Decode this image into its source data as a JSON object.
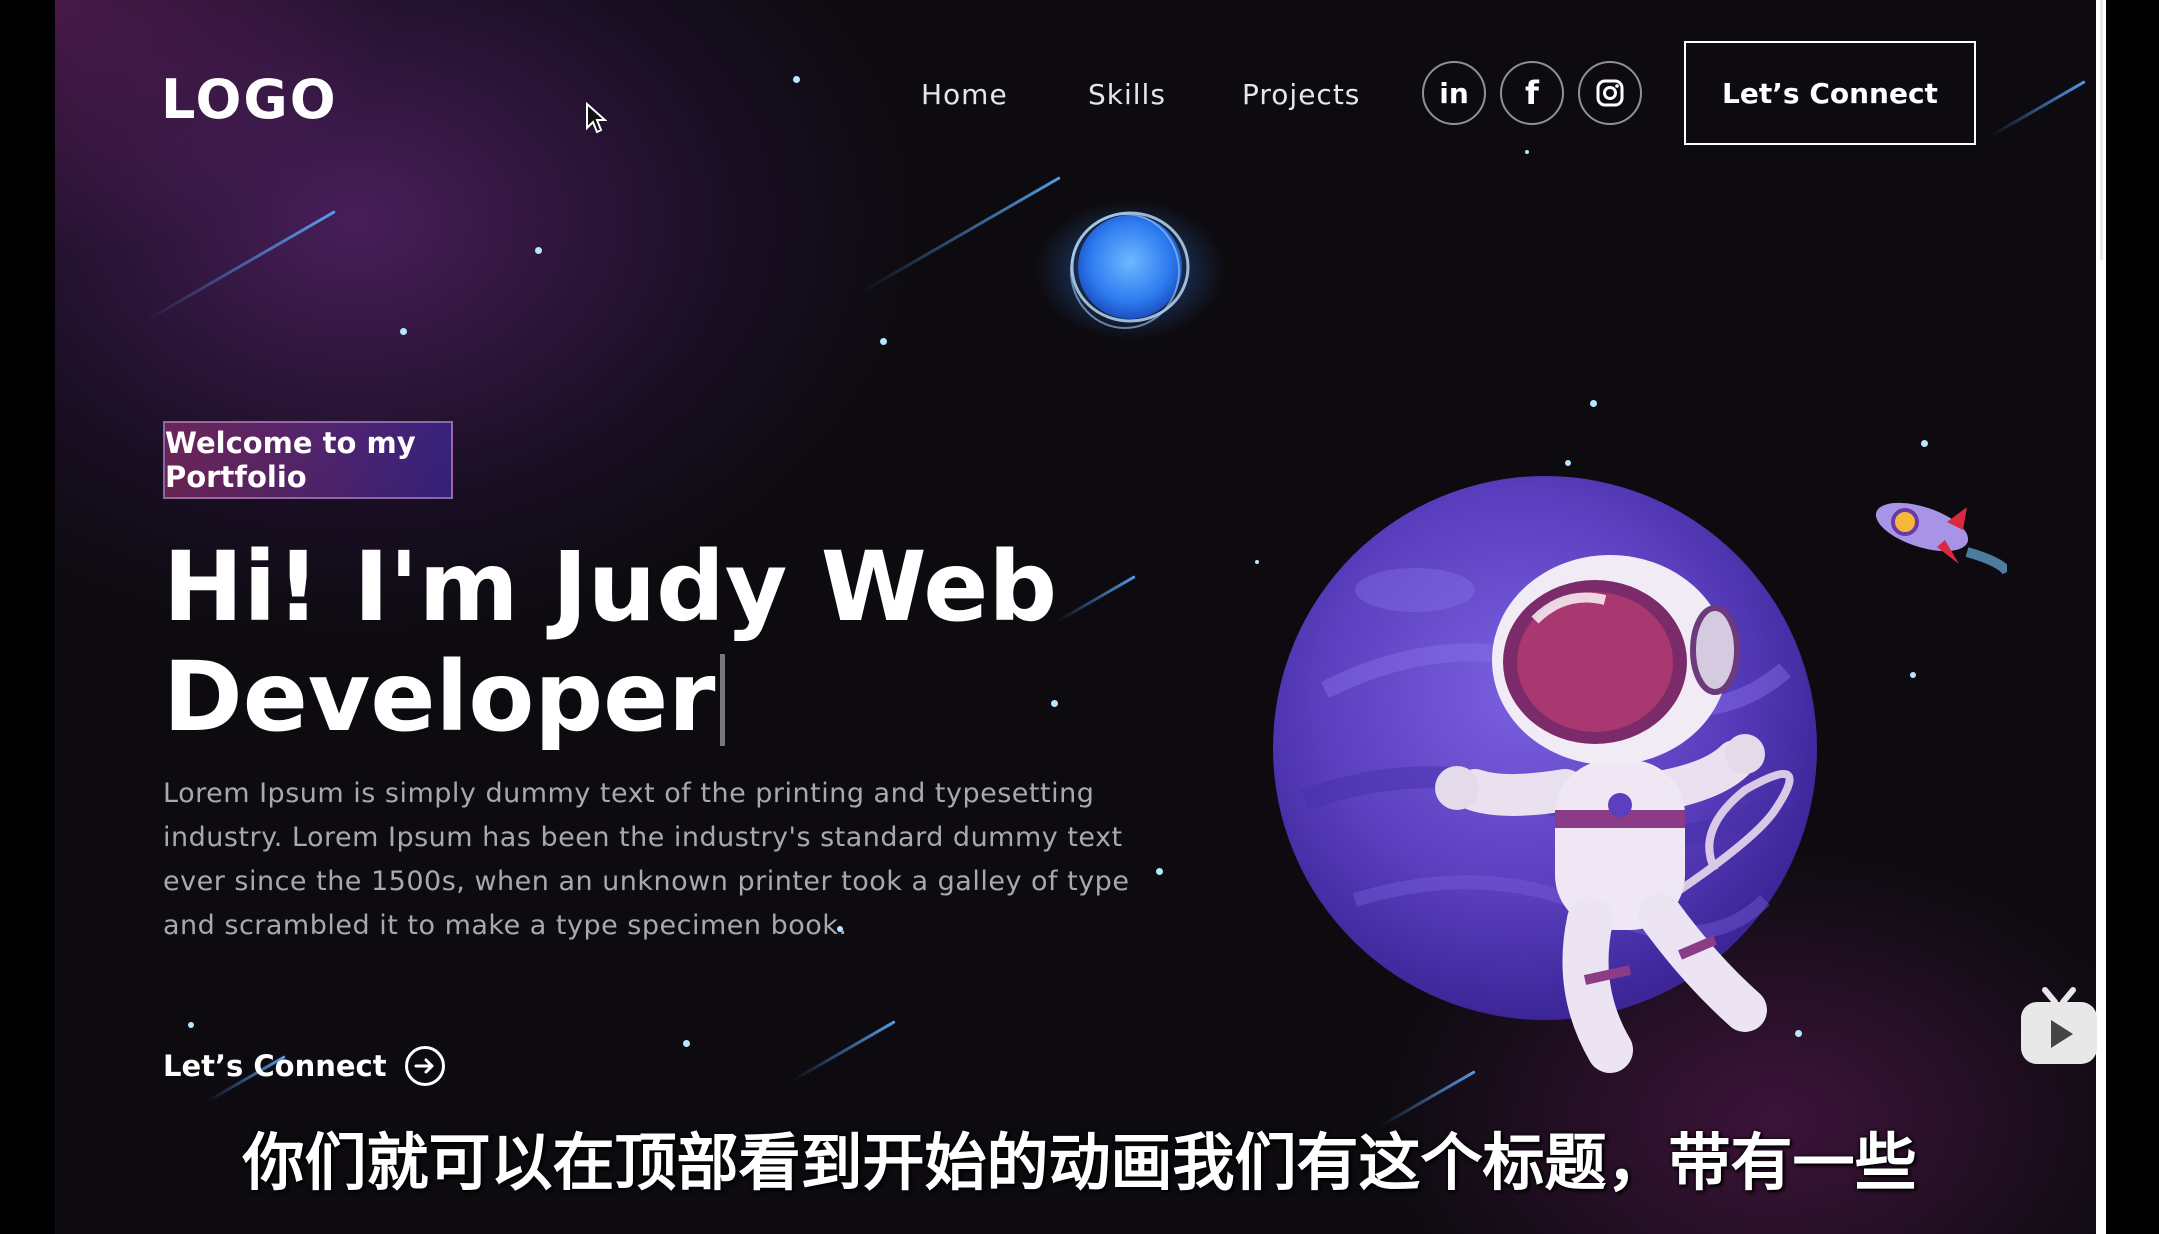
{
  "logo": "LOGO",
  "nav": {
    "links": [
      "Home",
      "Skills",
      "Projects"
    ],
    "social_icons": [
      "linkedin-icon",
      "facebook-icon",
      "instagram-icon"
    ],
    "social_glyphs": [
      "in",
      "f",
      ""
    ],
    "connect_button": "Let’s Connect"
  },
  "hero": {
    "tagline": "Welcome to my Portfolio",
    "title_line1": "Hi! I'm Judy Web",
    "title_line2": "Developer",
    "description": "Lorem Ipsum is simply dummy text of the printing and typesetting industry. Lorem Ipsum has been the industry's standard dummy text ever since the 1500s, when an unknown printer took a galley of type and scrambled it to make a type specimen book.",
    "cta_label": "Let’s Connect"
  },
  "subtitle": "你们就可以在顶部看到开始的动画我们有这个标题，带有一些",
  "colors": {
    "background": "#0d0b10",
    "tagline_gradient_start": "#aa367c",
    "tagline_gradient_end": "#4a2fbd",
    "planet": "#5b3fbf",
    "text_muted": "#a9a9a9"
  }
}
